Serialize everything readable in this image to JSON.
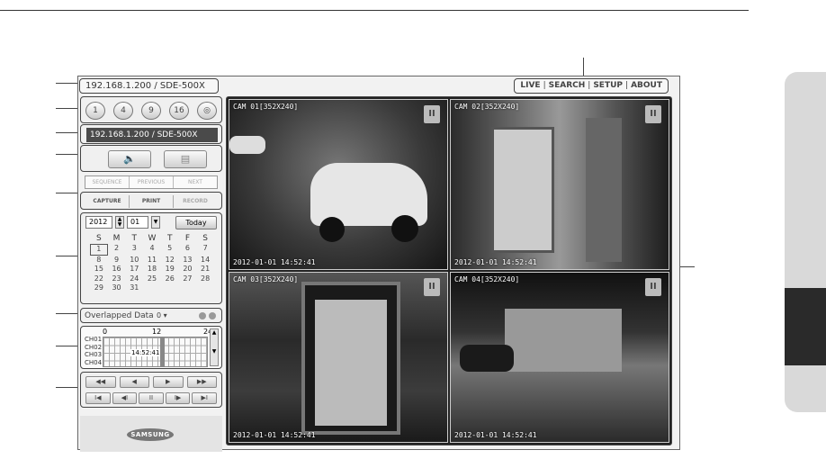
{
  "header": {
    "title": "192.168.1.200 / SDE-500X",
    "nav": [
      "LIVE",
      "SEARCH",
      "SETUP",
      "ABOUT"
    ]
  },
  "split_buttons": [
    "1",
    "4",
    "9",
    "16",
    "◎"
  ],
  "ip_display": "192.168.1.200  / SDE-500X",
  "sequence_buttons": [
    "SEQUENCE",
    "PREVIOUS",
    "NEXT"
  ],
  "capture_buttons": [
    "CAPTURE",
    "PRINT",
    "RECORD"
  ],
  "calendar": {
    "year": "2012",
    "month": "01",
    "today_label": "Today",
    "weekdays": [
      "S",
      "M",
      "T",
      "W",
      "T",
      "F",
      "S"
    ],
    "days": [
      "1",
      "2",
      "3",
      "4",
      "5",
      "6",
      "7",
      "8",
      "9",
      "10",
      "11",
      "12",
      "13",
      "14",
      "15",
      "16",
      "17",
      "18",
      "19",
      "20",
      "21",
      "22",
      "23",
      "24",
      "25",
      "26",
      "27",
      "28",
      "29",
      "30",
      "31",
      "",
      "",
      "",
      ""
    ],
    "selected_day": "1"
  },
  "overlapped": {
    "label": "Overlapped Data",
    "value": "0"
  },
  "timeline": {
    "ticks": [
      "0",
      "12",
      "24"
    ],
    "channels": [
      "CH01",
      "CH02",
      "CH03",
      "CH04"
    ],
    "current_time": "14:52:41"
  },
  "playback": {
    "row1": [
      "◀◀",
      "◀",
      "▶",
      "▶▶"
    ],
    "row2": [
      "I◀",
      "◀I",
      "II",
      "I▶",
      "▶I"
    ]
  },
  "brand": "SAMSUNG",
  "cameras": [
    {
      "title": "CAM 01[352X240]",
      "timestamp": "2012-01-01  14:52:41"
    },
    {
      "title": "CAM 02[352X240]",
      "timestamp": "2012-01-01  14:52:41"
    },
    {
      "title": "CAM 03[352X240]",
      "timestamp": "2012-01-01  14:52:41"
    },
    {
      "title": "CAM 04[352X240]",
      "timestamp": "2012-01-01  14:52:41"
    }
  ],
  "pause_label": "II"
}
